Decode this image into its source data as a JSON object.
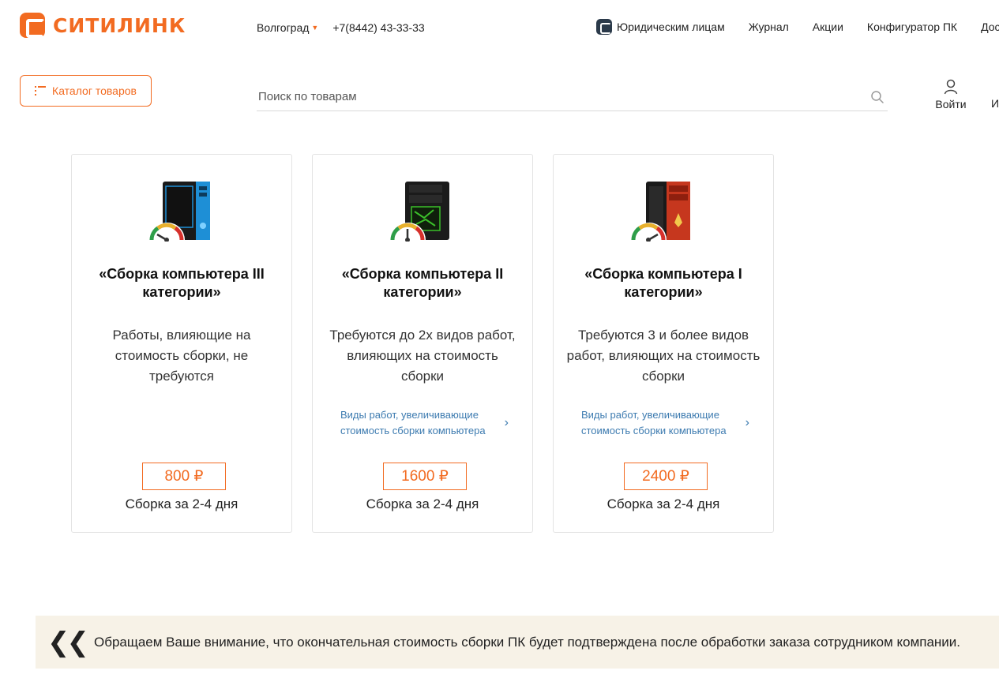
{
  "header": {
    "logo_text": "СИТИЛИНК",
    "city": "Волгоград",
    "phone": "+7(8442) 43-33-33",
    "nav": [
      "Юридическим лицам",
      "Журнал",
      "Акции",
      "Конфигуратор ПК",
      "Дос"
    ],
    "brand_color": "#f26b21"
  },
  "toolbar": {
    "catalog_label": "Каталог товаров",
    "search_placeholder": "Поиск по товарам",
    "login_label": "Войти",
    "extra_label": "И"
  },
  "cards": [
    {
      "title": "«Сборка компьютера III категории»",
      "description": "Работы, влияющие на стоимость сборки, не требуются",
      "link": "",
      "price": "800 ₽",
      "days": "Сборка за 2-4 дня",
      "case_color": "#1e8fd6"
    },
    {
      "title": "«Сборка компьютера II категории»",
      "description": "Требуются до 2х видов работ, влияющих на стоимость сборки",
      "link": "Виды работ, увеличивающие стоимость сборки компьютера",
      "price": "1600 ₽",
      "days": "Сборка за 2-4 дня",
      "case_color": "#3bbf2a"
    },
    {
      "title": "«Сборка компьютера I категории»",
      "description": "Требуются 3 и более видов работ, влияющих на стоимость сборки",
      "link": "Виды работ, увеличивающие стоимость сборки компьютера",
      "price": "2400 ₽",
      "days": "Сборка за 2-4 дня",
      "case_color": "#c6371e"
    }
  ],
  "notice": {
    "text": "Обращаем Ваше внимание, что окончательная стоимость сборки ПК будет подтверждена после обработки заказа сотрудником компании."
  }
}
